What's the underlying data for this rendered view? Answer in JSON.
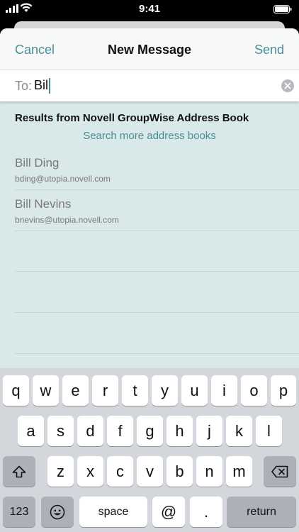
{
  "status": {
    "time": "9:41"
  },
  "nav": {
    "cancel": "Cancel",
    "title": "New Message",
    "send": "Send"
  },
  "to": {
    "label": "To:",
    "value": "Bill"
  },
  "results": {
    "header": "Results from Novell GroupWise Address Book",
    "search_more": "Search more address books",
    "items": [
      {
        "name": "Bill Ding",
        "email": "bding@utopia.novell.com"
      },
      {
        "name": "Bill Nevins",
        "email": "bnevins@utopia.novell.com"
      }
    ]
  },
  "keyboard": {
    "row1": [
      "q",
      "w",
      "e",
      "r",
      "t",
      "y",
      "u",
      "i",
      "o",
      "p"
    ],
    "row2": [
      "a",
      "s",
      "d",
      "f",
      "g",
      "h",
      "j",
      "k",
      "l"
    ],
    "row3": [
      "z",
      "x",
      "c",
      "v",
      "b",
      "n",
      "m"
    ],
    "numbers": "123",
    "space": "space",
    "at": "@",
    "period": ".",
    "return": "return"
  }
}
